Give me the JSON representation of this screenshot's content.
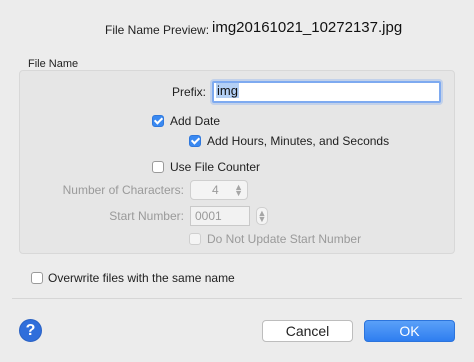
{
  "preview": {
    "label": "File Name Preview:",
    "value": "img20161021_10272137.jpg"
  },
  "file_name_group": {
    "title": "File Name",
    "prefix_label": "Prefix:",
    "prefix_value": "img",
    "add_date": {
      "label": "Add Date",
      "checked": true
    },
    "add_time": {
      "label": "Add Hours, Minutes, and Seconds",
      "checked": true
    },
    "use_counter": {
      "label": "Use File Counter",
      "checked": false
    },
    "num_chars": {
      "label": "Number of Characters:",
      "value": "4"
    },
    "start_number": {
      "label": "Start Number:",
      "value": "0001"
    },
    "no_update": {
      "label": "Do Not Update Start Number",
      "checked": false,
      "enabled": false
    }
  },
  "overwrite": {
    "label": "Overwrite files with the same name",
    "checked": false
  },
  "footer": {
    "help_icon": "question-mark-icon",
    "help_glyph": "?",
    "cancel_label": "Cancel",
    "ok_label": "OK"
  },
  "colors": {
    "accent": "#3a89f1",
    "ok_button": "#2f7ef0",
    "help_button": "#2f6edb",
    "window_bg": "#ececec"
  }
}
